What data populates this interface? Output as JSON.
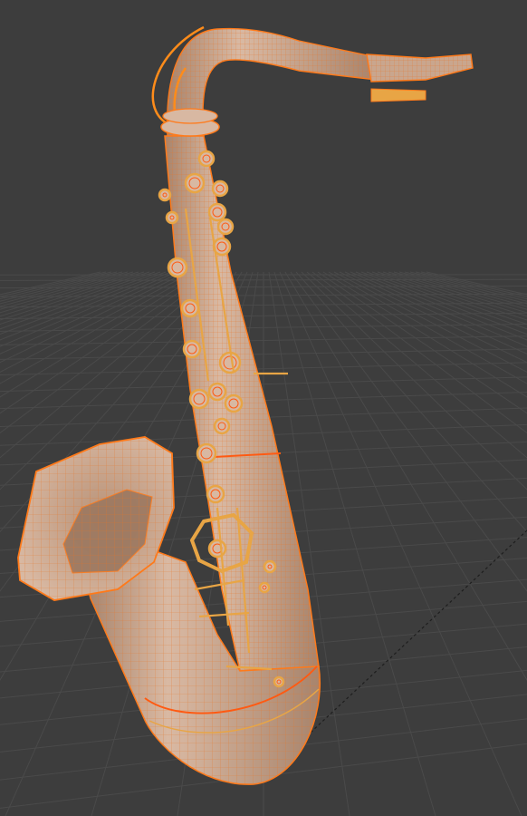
{
  "viewport": {
    "background": "#3d3d3d",
    "grid_color": "#4a4a4a",
    "grid_color_minor": "#444444",
    "axis_line_color": "#1e1e1e"
  },
  "object": {
    "name_icon": "saxophone-mesh",
    "body_color": "#c7a48c",
    "body_shade": "#a8846c",
    "wire_color": "#ff8c1a",
    "wire_edge": "#ff5a12",
    "key_color": "#e8a545"
  }
}
